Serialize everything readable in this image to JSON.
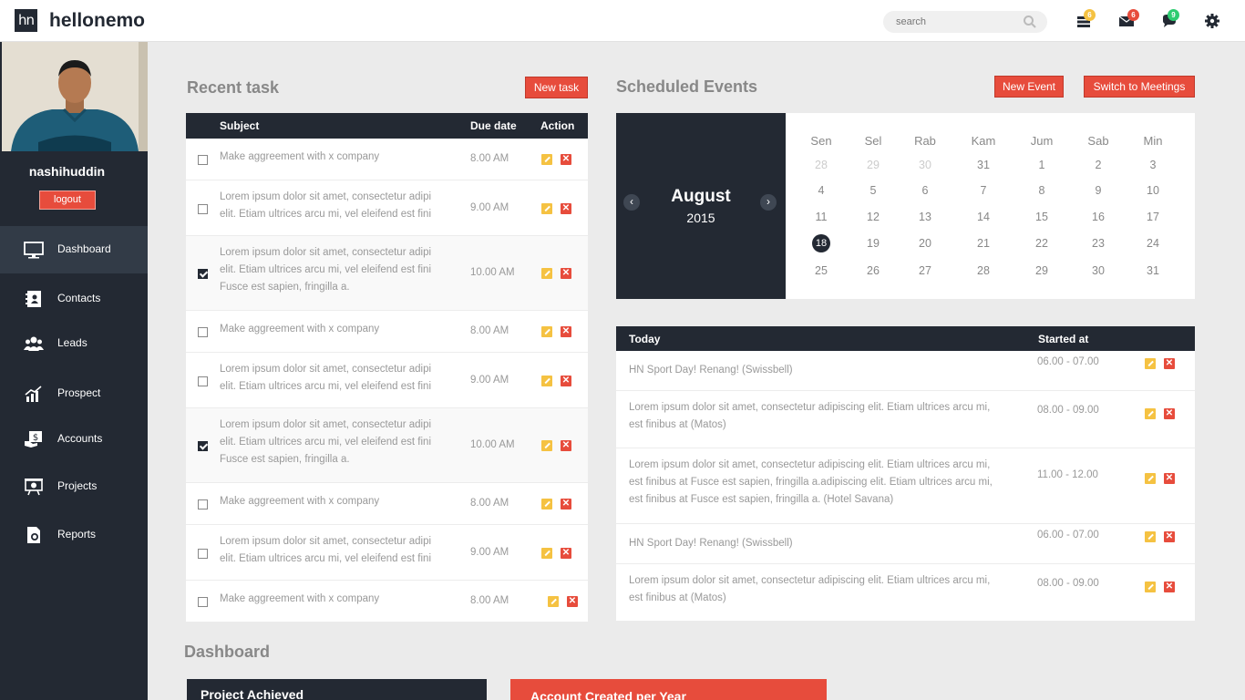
{
  "app": {
    "logo_text": "hn",
    "brand": "hellonemo",
    "search_placeholder": "search",
    "badges": {
      "stack": "6",
      "mail": "6",
      "chat": "9"
    }
  },
  "sidebar": {
    "username": "nashihuddin",
    "logout_label": "logout",
    "items": [
      {
        "label": "Dashboard",
        "icon": "monitor-icon"
      },
      {
        "label": "Contacts",
        "icon": "address-book-icon"
      },
      {
        "label": "Leads",
        "icon": "users-icon"
      },
      {
        "label": "Prospect",
        "icon": "chart-icon"
      },
      {
        "label": "Accounts",
        "icon": "money-icon"
      },
      {
        "label": "Projects",
        "icon": "presentation-icon"
      },
      {
        "label": "Reports",
        "icon": "report-icon"
      }
    ]
  },
  "tasks": {
    "title": "Recent task",
    "new_label": "New task",
    "columns": {
      "subject": "Subject",
      "due": "Due date",
      "action": "Action"
    },
    "rows": [
      {
        "subject": "Make aggreement with x company",
        "due": "8.00 AM",
        "checked": false
      },
      {
        "subject": "Lorem ipsum dolor sit amet, consectetur adipi elit. Etiam ultrices arcu mi, vel eleifend est fini",
        "due": "9.00 AM",
        "checked": false
      },
      {
        "subject": "Lorem ipsum dolor sit amet, consectetur adipi elit. Etiam ultrices arcu mi, vel eleifend est fini Fusce est sapien, fringilla a.",
        "due": "10.00 AM",
        "checked": true
      },
      {
        "subject": "Make aggreement with x company",
        "due": "8.00 AM",
        "checked": false
      },
      {
        "subject": "Lorem ipsum dolor sit amet, consectetur adipi elit. Etiam ultrices arcu mi, vel eleifend est fini",
        "due": "9.00 AM",
        "checked": false
      },
      {
        "subject": "Lorem ipsum dolor sit amet, consectetur adipi elit. Etiam ultrices arcu mi, vel eleifend est fini Fusce est sapien, fringilla a.",
        "due": "10.00 AM",
        "checked": true
      },
      {
        "subject": "Make aggreement with x company",
        "due": "8.00 AM",
        "checked": false
      },
      {
        "subject": "Lorem ipsum dolor sit amet, consectetur adipi elit. Etiam ultrices arcu mi, vel eleifend est fini",
        "due": "9.00 AM",
        "checked": false
      },
      {
        "subject": "Make aggreement with x company",
        "due": "8.00 AM",
        "checked": false
      }
    ]
  },
  "events": {
    "title": "Scheduled Events",
    "new_label": "New Event",
    "switch_label": "Switch to Meetings",
    "calendar": {
      "month": "August",
      "year": "2015",
      "prev": "‹",
      "next": "›",
      "days_of_week": [
        "Sen",
        "Sel",
        "Rab",
        "Kam",
        "Jum",
        "Sab",
        "Min"
      ],
      "weeks": [
        [
          "28",
          "29",
          "30",
          "31",
          "1",
          "2",
          "3"
        ],
        [
          "4",
          "5",
          "6",
          "7",
          "8",
          "9",
          "10"
        ],
        [
          "11",
          "12",
          "13",
          "14",
          "15",
          "16",
          "17"
        ],
        [
          "18",
          "19",
          "20",
          "21",
          "22",
          "23",
          "24"
        ],
        [
          "25",
          "26",
          "27",
          "28",
          "29",
          "30",
          "31"
        ]
      ],
      "selected_day": "18"
    },
    "table": {
      "col_today": "Today",
      "col_started": "Started at",
      "rows": [
        {
          "text": "HN Sport Day! Renang! (Swissbell)",
          "time": "06.00 - 07.00"
        },
        {
          "text": "Lorem ipsum dolor sit amet, consectetur adipiscing elit. Etiam ultrices arcu mi, est finibus at (Matos)",
          "time": "08.00 - 09.00"
        },
        {
          "text": "Lorem ipsum dolor sit amet, consectetur adipiscing elit. Etiam ultrices arcu mi, est finibus at Fusce est sapien, fringilla a.adipiscing elit. Etiam ultrices arcu mi, est finibus at Fusce est sapien, fringilla a. (Hotel Savana)",
          "time": "11.00 - 12.00"
        },
        {
          "text": "HN Sport Day! Renang! (Swissbell)",
          "time": "06.00 - 07.00"
        },
        {
          "text": "Lorem ipsum dolor sit amet, consectetur adipiscing elit. Etiam ultrices arcu mi, est finibus at (Matos)",
          "time": "08.00 - 09.00"
        }
      ]
    }
  },
  "dashboard": {
    "title": "Dashboard",
    "cards": [
      {
        "label": "Project Achieved",
        "color": "#232933"
      },
      {
        "label": "Account Created per Year",
        "color": "#e74c3c"
      }
    ]
  }
}
